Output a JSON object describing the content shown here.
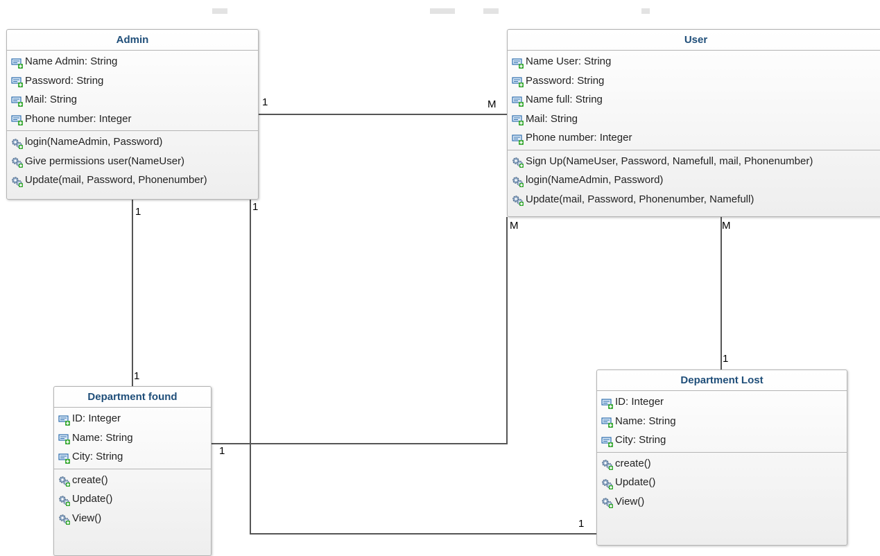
{
  "classes": {
    "admin": {
      "name": "Admin",
      "attributes": [
        "Name Admin: String",
        "Password: String",
        "Mail: String",
        "Phone number: Integer"
      ],
      "operations": [
        "login(NameAdmin, Password)",
        "Give permissions user(NameUser)",
        "Update(mail, Password, Phonenumber)"
      ]
    },
    "user": {
      "name": "User",
      "attributes": [
        "Name User: String",
        "Password: String",
        "Name full: String",
        "Mail: String",
        "Phone number: Integer"
      ],
      "operations": [
        "Sign Up(NameUser, Password, Namefull, mail, Phonenumber)",
        "login(NameAdmin, Password)",
        "Update(mail, Password, Phonenumber, Namefull)"
      ]
    },
    "dept_found": {
      "name": "Department found",
      "attributes": [
        "ID: Integer",
        "Name: String",
        "City: String"
      ],
      "operations": [
        "create()",
        "Update()",
        "View()"
      ]
    },
    "dept_lost": {
      "name": "Department Lost",
      "attributes": [
        "ID: Integer",
        "Name: String",
        "City: String"
      ],
      "operations": [
        "create()",
        "Update()",
        "View()"
      ]
    }
  },
  "multiplicities": {
    "admin_user_admin_end": "1",
    "admin_user_user_end": "M",
    "admin_found_admin_end": "1",
    "admin_found_found_end": "1",
    "admin_lost_admin_end": "1",
    "admin_lost_lost_end": "1",
    "user_found_user_end": "M",
    "user_found_found_end": "1",
    "user_lost_user_end": "M",
    "user_lost_lost_end": "1"
  },
  "icons": {
    "attribute": "attribute-icon",
    "operation": "operation-gear-icon"
  },
  "colors": {
    "class_title": "#1f4e79",
    "connector": "#555555",
    "box_border": "#b4b4b4"
  }
}
